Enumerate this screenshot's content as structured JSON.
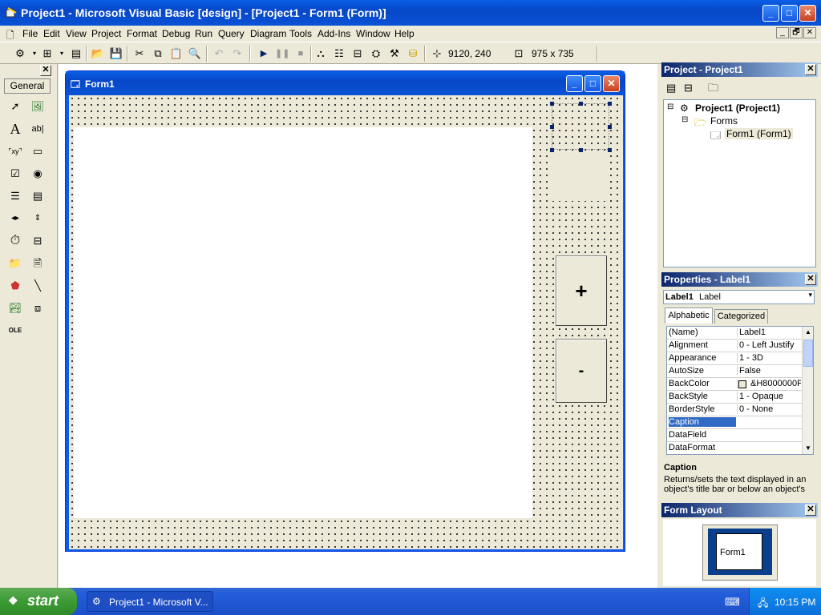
{
  "window": {
    "title": "Project1 - Microsoft Visual Basic [design] - [Project1 - Form1 (Form)]",
    "min_glyph": "_",
    "max_glyph": "□",
    "close_glyph": "✕"
  },
  "menu": [
    "File",
    "Edit",
    "View",
    "Project",
    "Format",
    "Debug",
    "Run",
    "Query",
    "Diagram",
    "Tools",
    "Add-Ins",
    "Window",
    "Help"
  ],
  "mdi_controls": [
    "_",
    "🗗",
    "✕"
  ],
  "toolbar": {
    "position": "9120, 240",
    "size": "975 x 735"
  },
  "toolbox": {
    "tab_label": "General",
    "tools": [
      "pointer-icon",
      "picturebox-icon",
      "label-icon",
      "textbox-icon",
      "frame-icon",
      "commandbutton-icon",
      "checkbox-icon",
      "optionbutton-icon",
      "combobox-icon",
      "listbox-icon",
      "hscrollbar-icon",
      "vscrollbar-icon",
      "timer-icon",
      "drivelistbox-icon",
      "dirlistbox-icon",
      "filelistbox-icon",
      "shape-icon",
      "line-icon",
      "image-icon",
      "data-icon",
      "ole-icon"
    ]
  },
  "form": {
    "title": "Form1",
    "plus_caption": "+",
    "minus_caption": "-"
  },
  "project_panel": {
    "title": "Project - Project1",
    "root": "Project1 (Project1)",
    "folder": "Forms",
    "item": "Form1 (Form1)"
  },
  "properties_panel": {
    "title": "Properties - Label1",
    "object_name": "Label1",
    "object_type": "Label",
    "tabs": [
      "Alphabetic",
      "Categorized"
    ],
    "rows": [
      {
        "name": "(Name)",
        "value": "Label1"
      },
      {
        "name": "Alignment",
        "value": "0 - Left Justify"
      },
      {
        "name": "Appearance",
        "value": "1 - 3D"
      },
      {
        "name": "AutoSize",
        "value": "False"
      },
      {
        "name": "BackColor",
        "value": "&H8000000F"
      },
      {
        "name": "BackStyle",
        "value": "1 - Opaque"
      },
      {
        "name": "BorderStyle",
        "value": "0 - None"
      },
      {
        "name": "Caption",
        "value": ""
      },
      {
        "name": "DataField",
        "value": ""
      },
      {
        "name": "DataFormat",
        "value": ""
      }
    ],
    "desc_title": "Caption",
    "desc_text": "Returns/sets the text displayed in an object's title bar or below an object's"
  },
  "layout_panel": {
    "title": "Form Layout",
    "preview_label": "Form1"
  },
  "taskbar": {
    "start": "start",
    "task": "Project1 - Microsoft V...",
    "clock": "10:15 PM"
  }
}
